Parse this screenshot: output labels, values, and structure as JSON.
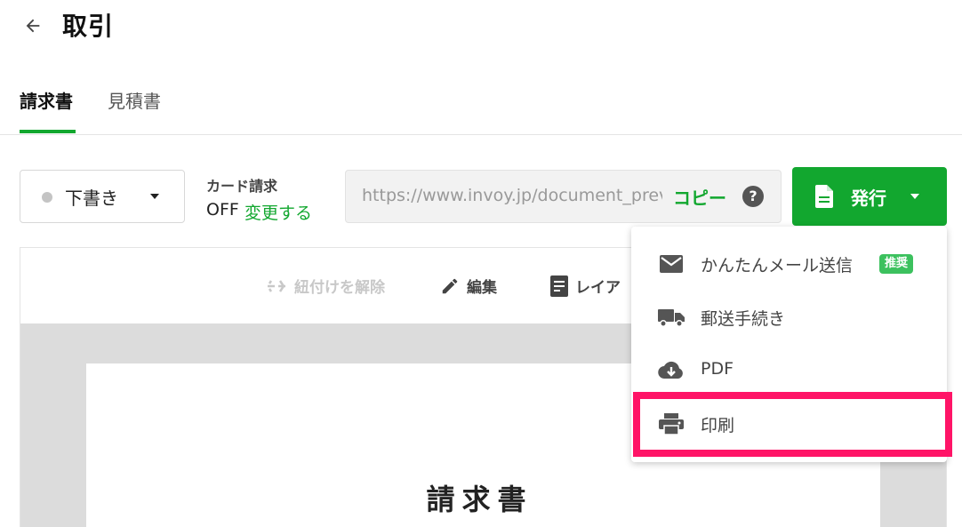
{
  "header": {
    "title": "取引",
    "back_icon": "arrow-left-icon"
  },
  "tabs": [
    {
      "label": "請求書",
      "active": true
    },
    {
      "label": "見積書",
      "active": false
    }
  ],
  "status": {
    "label": "下書き",
    "dot_color": "#c4c4c4"
  },
  "card_billing": {
    "title": "カード請求",
    "state": "OFF",
    "change_label": "変更する"
  },
  "url": {
    "value": "https://www.invoy.jp/document_preview",
    "copy_label": "コピー",
    "help_glyph": "?"
  },
  "issue_button": {
    "label": "発行",
    "icon": "document-icon"
  },
  "doc_toolbar": {
    "unlink_label": "紐付けを解除",
    "edit_label": "編集",
    "layout_label": "レイア"
  },
  "document": {
    "heading": "請求書"
  },
  "menu": {
    "items": [
      {
        "label": "かんたんメール送信",
        "icon": "mail-icon",
        "badge": "推奨"
      },
      {
        "label": "郵送手続き",
        "icon": "truck-icon"
      },
      {
        "label": "PDF",
        "icon": "cloud-download-icon"
      },
      {
        "label": "印刷",
        "icon": "printer-icon",
        "highlighted": true
      }
    ]
  },
  "colors": {
    "accent": "#12a72f",
    "highlight": "#ff1467",
    "badge": "#3cc15e"
  }
}
